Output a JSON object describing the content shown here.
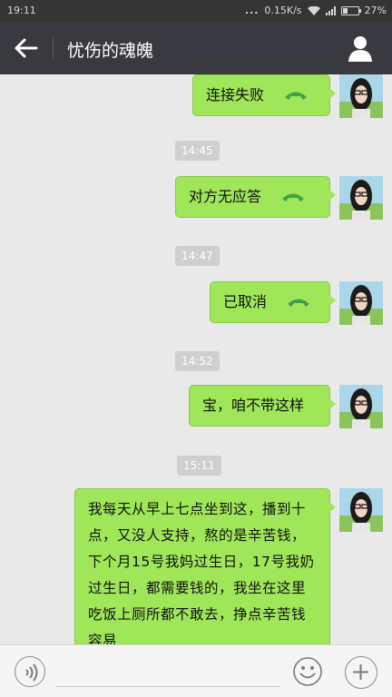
{
  "status_bar": {
    "time": "19:11",
    "dots": "...",
    "speed": "0.15K/s",
    "battery": "27%"
  },
  "header": {
    "title": "忧伤的魂魄"
  },
  "messages": [
    {
      "type": "call",
      "text": "连接失败"
    },
    {
      "type": "time",
      "text": "14:45"
    },
    {
      "type": "call",
      "text": "对方无应答"
    },
    {
      "type": "time",
      "text": "14:47"
    },
    {
      "type": "call",
      "text": "已取消"
    },
    {
      "type": "time",
      "text": "14:52"
    },
    {
      "type": "text",
      "text": "宝，咱不带这样"
    },
    {
      "type": "time",
      "text": "15:11"
    },
    {
      "type": "text",
      "text": "我每天从早上七点坐到这，播到十点，又没人支持，熬的是辛苦钱，下个月15号我妈过生日，17号我奶过生日，都需要钱的，我坐在这里吃饭上厕所都不敢去，挣点辛苦钱容易"
    }
  ],
  "colors": {
    "bubble": "#9fe659",
    "header": "#393a3f",
    "phone_icon": "#43a04a"
  }
}
